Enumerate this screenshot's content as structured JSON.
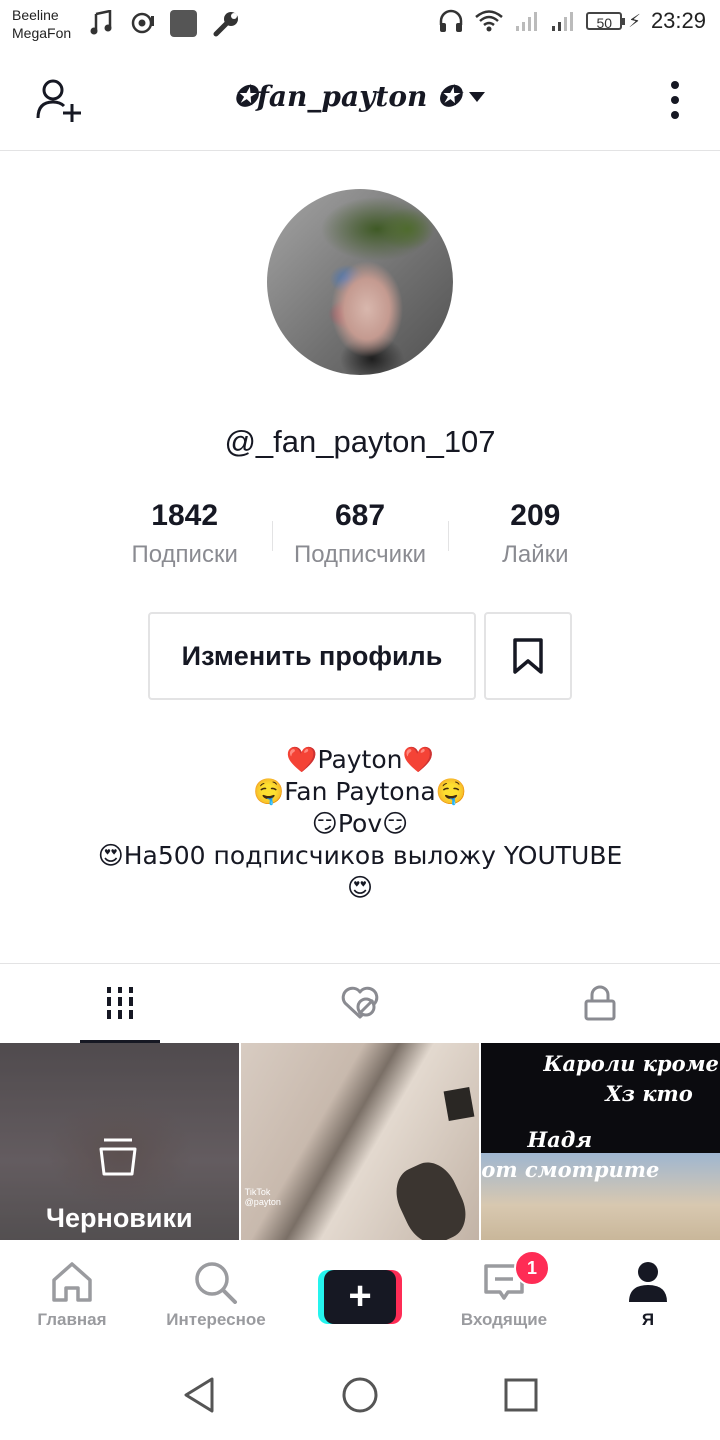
{
  "status_bar": {
    "carrier_1": "Beeline",
    "carrier_2": "MegaFon",
    "battery": "50",
    "time": "23:29"
  },
  "header": {
    "title": "✪fan_payton ✪"
  },
  "profile": {
    "handle": "@_fan_payton_107",
    "stats": [
      {
        "value": "1842",
        "label": "Подписки"
      },
      {
        "value": "687",
        "label": "Подписчики"
      },
      {
        "value": "209",
        "label": "Лайки"
      }
    ],
    "edit_button": "Изменить профиль",
    "bio": [
      "❤️Payton❤️",
      "🤤Fan Paytona🤤",
      "😏Pov😏",
      "😍На500 подписчиков выложу YOUTUBE",
      "😍"
    ]
  },
  "tabs": [
    "videos",
    "liked",
    "private"
  ],
  "grid": {
    "drafts_label": "Черновики",
    "tiktok_watermark": "TikTok",
    "tiktok_watermark_user": "@payton",
    "cell3_caption_1": "Кароли кроме т",
    "cell3_caption_2": "Хз кто",
    "cell3_caption_3": "Надя",
    "cell3_caption_4": "от смотрите"
  },
  "bottom_nav": {
    "home": "Главная",
    "discover": "Интересное",
    "inbox": "Входящие",
    "inbox_badge": "1",
    "me": "Я"
  },
  "colors": {
    "accent_red": "#fe2c55",
    "accent_cyan": "#25f4ee",
    "text_primary": "#161823",
    "text_secondary": "#8a8b91"
  }
}
